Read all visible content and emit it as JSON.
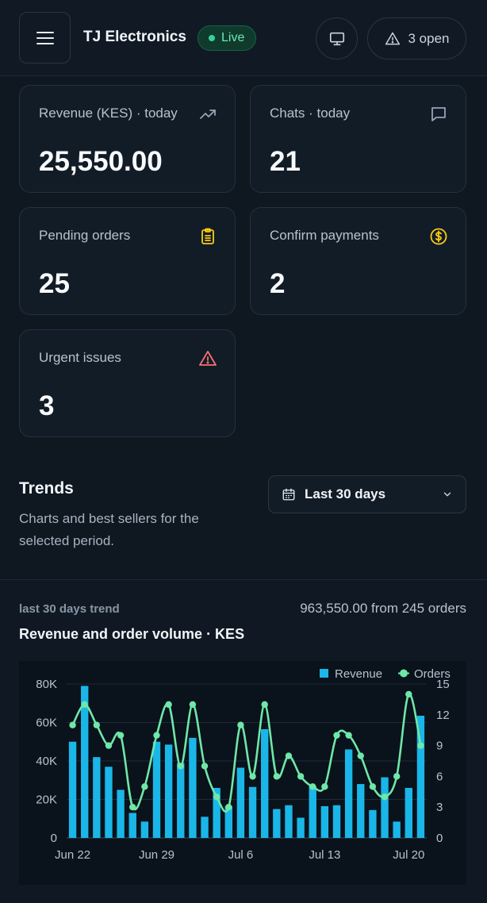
{
  "header": {
    "brand": "TJ Electronics",
    "live_label": "Live",
    "open_label": "3 open",
    "icons": [
      "menu-icon",
      "monitor-icon",
      "warning-icon"
    ]
  },
  "cards": [
    {
      "label": "Revenue (KES) · today",
      "value": "25,550.00",
      "icon": "trending-up-icon"
    },
    {
      "label": "Chats · today",
      "value": "21",
      "icon": "chat-icon"
    },
    {
      "label": "Pending orders",
      "value": "25",
      "icon": "clipboard-icon"
    },
    {
      "label": "Confirm payments",
      "value": "2",
      "icon": "dollar-circle-icon"
    },
    {
      "label": "Urgent issues",
      "value": "3",
      "icon": "warning-icon"
    }
  ],
  "trends": {
    "title": "Trends",
    "subtitle": "Charts and best sellers for the selected period.",
    "range_value": "Last 30 days"
  },
  "chart_section": {
    "eyebrow": "last 30 days trend",
    "total": "963,550.00 from 245 orders",
    "title": "Revenue and order volume · KES"
  },
  "colors": {
    "revenue": "#1ab6e8",
    "orders": "#6ee7a8",
    "live": "#34d399",
    "warning": "#f87171",
    "gold": "#facc15"
  },
  "chart_data": {
    "type": "bar",
    "x": [
      "Jun 22",
      "Jun 23",
      "Jun 24",
      "Jun 25",
      "Jun 26",
      "Jun 27",
      "Jun 28",
      "Jun 29",
      "Jun 30",
      "Jul 1",
      "Jul 2",
      "Jul 3",
      "Jul 4",
      "Jul 5",
      "Jul 6",
      "Jul 7",
      "Jul 8",
      "Jul 9",
      "Jul 10",
      "Jul 11",
      "Jul 12",
      "Jul 13",
      "Jul 14",
      "Jul 15",
      "Jul 16",
      "Jul 17",
      "Jul 18",
      "Jul 19",
      "Jul 20",
      "Jul 21"
    ],
    "x_tick_labels": [
      "Jun 22",
      "Jun 29",
      "Jul 6",
      "Jul 13",
      "Jul 20"
    ],
    "series": [
      {
        "name": "Revenue",
        "axis": "left",
        "type": "bar",
        "values": [
          50000,
          79000,
          42000,
          37000,
          25000,
          13000,
          8500,
          50000,
          48500,
          39000,
          52000,
          11000,
          26000,
          16500,
          36500,
          26500,
          56500,
          15000,
          17000,
          10500,
          27000,
          16500,
          17000,
          46000,
          28000,
          14500,
          31500,
          8500,
          26000,
          63500
        ]
      },
      {
        "name": "Orders",
        "axis": "right",
        "type": "line",
        "values": [
          11,
          13,
          11,
          9,
          10,
          3,
          5,
          10,
          13,
          7,
          13,
          7,
          4,
          3,
          11,
          6,
          13,
          6,
          8,
          6,
          5,
          5,
          10,
          10,
          8,
          5,
          4,
          6,
          14,
          9
        ]
      }
    ],
    "left_axis": {
      "ylim": [
        0,
        80000
      ],
      "ticks": [
        "0",
        "20K",
        "40K",
        "60K",
        "80K"
      ],
      "tick_values": [
        0,
        20000,
        40000,
        60000,
        80000
      ]
    },
    "right_axis": {
      "ylim": [
        0,
        15
      ],
      "ticks": [
        "0",
        "3",
        "6",
        "9",
        "12",
        "15"
      ],
      "tick_values": [
        0,
        3,
        6,
        9,
        12,
        15
      ]
    },
    "legend": [
      "Revenue",
      "Orders"
    ],
    "legend_position": "top-right",
    "grid": true
  }
}
